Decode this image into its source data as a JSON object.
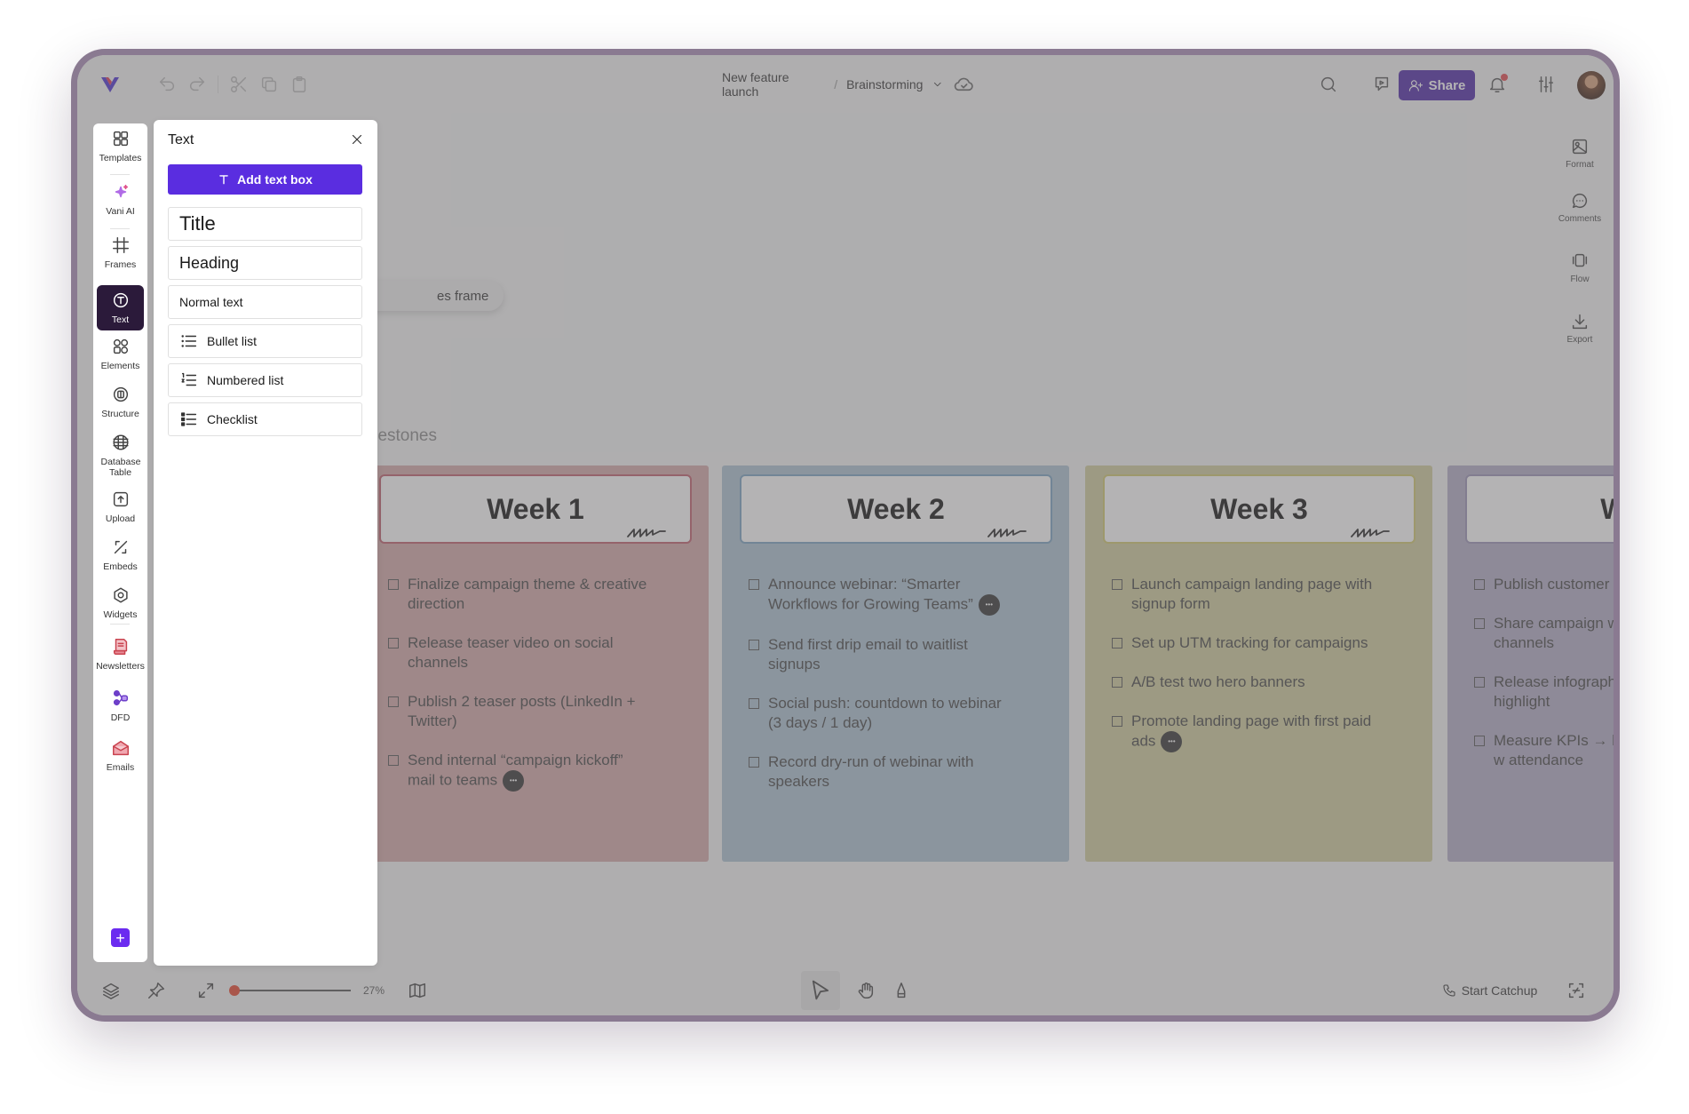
{
  "header": {
    "doc_name": "New feature launch",
    "separator": "/",
    "page_name": "Brainstorming",
    "share_label": "Share"
  },
  "left_toolbar": [
    {
      "label": "Templates",
      "icon": "grid-icon"
    },
    {
      "label": "Vani AI",
      "icon": "sparkle-icon"
    },
    {
      "label": "Frames",
      "icon": "frame-icon"
    },
    {
      "label": "Text",
      "icon": "text-icon",
      "selected": true
    },
    {
      "label": "Elements",
      "icon": "shapes-icon"
    },
    {
      "label": "Structure",
      "icon": "structure-icon"
    },
    {
      "label": "Database Table",
      "icon": "database-table-icon"
    },
    {
      "label": "Upload",
      "icon": "upload-icon"
    },
    {
      "label": "Embeds",
      "icon": "embed-icon"
    },
    {
      "label": "Widgets",
      "icon": "widget-icon"
    },
    {
      "label": "Newsletters",
      "icon": "newsletter-icon"
    },
    {
      "label": "DFD",
      "icon": "dfd-icon"
    },
    {
      "label": "Emails",
      "icon": "email-icon"
    }
  ],
  "text_panel": {
    "title": "Text",
    "add_button": "Add text box",
    "options": [
      "Title",
      "Heading",
      "Normal text",
      "Bullet list",
      "Numbered list",
      "Checklist"
    ]
  },
  "canvas": {
    "frame_pill": "es frame",
    "milestones_label": "ilestones",
    "columns": [
      {
        "title": "Week 1",
        "color": "#d5a8a8",
        "border": "#c05e6c",
        "tasks": [
          "Finalize campaign theme & creative direction",
          "Release teaser video on social channels",
          "Publish 2 teaser posts (LinkedIn + Twitter)",
          "Send internal “campaign kickoff” mail to teams"
        ],
        "comment_on": 3
      },
      {
        "title": "Week 2",
        "color": "#acc2d2",
        "border": "#7ba3c2",
        "tasks": [
          "Announce webinar: “Smarter Workflows for Growing Teams”",
          "Send first drip email to waitlist signups",
          "Social push: countdown to webinar (3 days / 1 day)",
          "Record dry-run of webinar with speakers"
        ],
        "comment_on": 0
      },
      {
        "title": "Week 3",
        "color": "#d0cd9c",
        "border": "#d0c86e",
        "tasks": [
          "Launch campaign landing page with signup form",
          "Set up UTM tracking for campaigns",
          "A/B test two hero banners",
          "Promote landing page with first paid ads"
        ],
        "comment_on": 3
      },
      {
        "title": "We",
        "color": "#b3adc6",
        "border": "#9a93b6",
        "tasks": [
          "Publish customer story (blog + video",
          "Share campaign w on social channels",
          "Release infograph campaign highlight",
          "Measure KPIs → le generated, CTR, w attendance"
        ],
        "comment_on": -1
      }
    ],
    "comment_glyph": "•••"
  },
  "right_toolbar": [
    {
      "label": "Format",
      "icon": "format-icon"
    },
    {
      "label": "Comments",
      "icon": "comment-icon"
    },
    {
      "label": "Flow",
      "icon": "flow-icon"
    },
    {
      "label": "Export",
      "icon": "export-icon"
    }
  ],
  "bottom": {
    "zoom_label": "27%",
    "zoom_fraction": 0.0,
    "start_catchup": "Start Catchup"
  },
  "plus_glyph": "+",
  "colors": {
    "accent": "#5a2de0",
    "share_bg": "#4c26a6",
    "selected_tool": "#2b1a3a",
    "notification_dot": "#e5484d"
  }
}
